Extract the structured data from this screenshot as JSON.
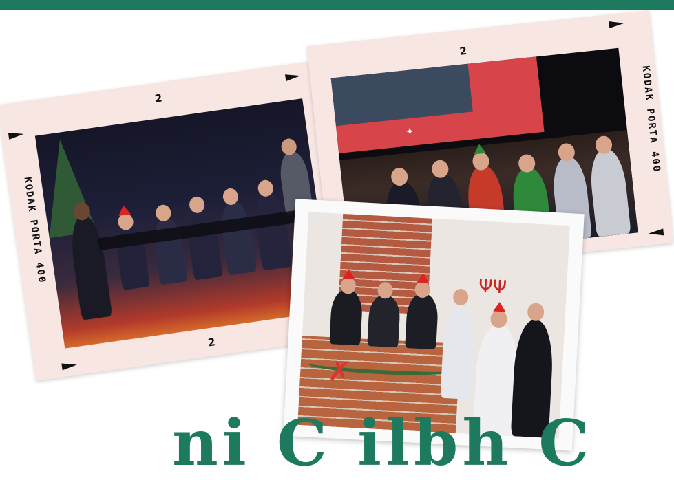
{
  "colors": {
    "brand_green": "#1e7a5e",
    "frame_pink": "#f8e6e3"
  },
  "photo_left": {
    "frame_number_top": "2",
    "frame_number_bottom": "2",
    "side_text": "KODAK  PORTA 400"
  },
  "photo_right": {
    "frame_number_top": "2",
    "side_text": "KODAK  PORTA 400"
  },
  "bottom_heading_partial": "ni C ilbh C"
}
